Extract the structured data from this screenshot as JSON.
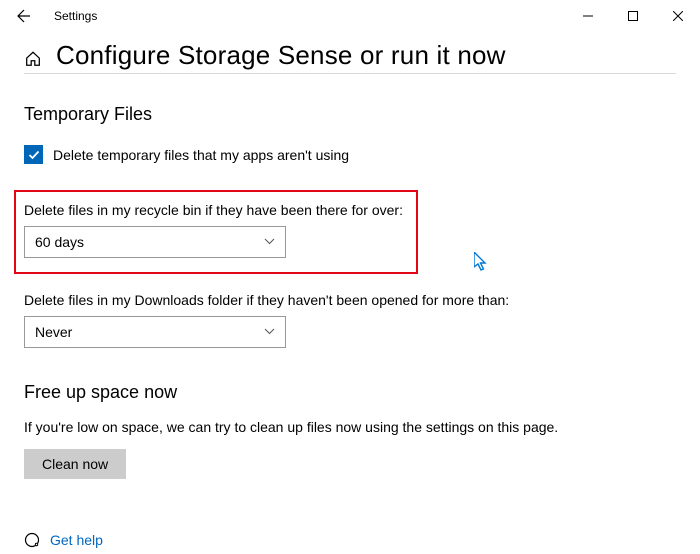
{
  "window": {
    "title": "Settings"
  },
  "page": {
    "title": "Configure Storage Sense or run it now"
  },
  "temporary_files": {
    "heading": "Temporary Files",
    "checkbox_label": "Delete temporary files that my apps aren't using",
    "checkbox_checked": true,
    "recycle": {
      "label": "Delete files in my recycle bin if they have been there for over:",
      "value": "60 days"
    },
    "downloads": {
      "label": "Delete files in my Downloads folder if they haven't been opened for more than:",
      "value": "Never"
    }
  },
  "free_up": {
    "heading": "Free up space now",
    "body": "If you're low on space, we can try to clean up files now using the settings on this page.",
    "button": "Clean now"
  },
  "help": {
    "link": "Get help"
  }
}
